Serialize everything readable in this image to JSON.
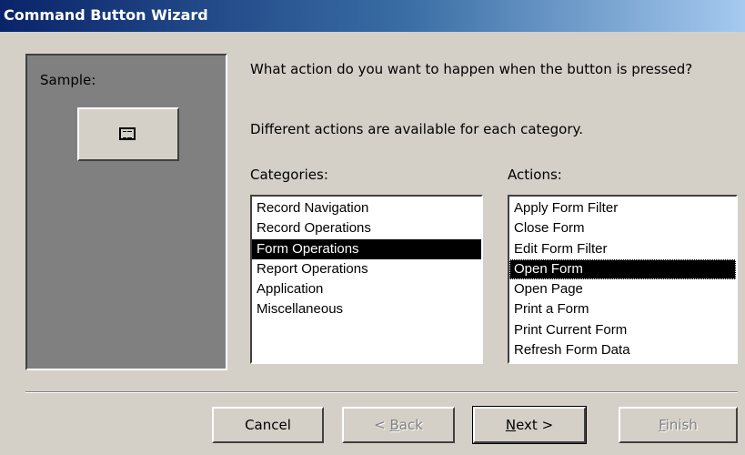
{
  "window": {
    "title": "Command Button Wizard"
  },
  "sample": {
    "label": "Sample:",
    "icon": "form-icon"
  },
  "question": "What action do you want to happen when the button is pressed?",
  "note": "Different actions are available for each category.",
  "categories": {
    "label": "Categories:",
    "items": [
      "Record Navigation",
      "Record Operations",
      "Form Operations",
      "Report Operations",
      "Application",
      "Miscellaneous"
    ],
    "selected": "Form Operations"
  },
  "actions": {
    "label": "Actions:",
    "items": [
      "Apply Form Filter",
      "Close Form",
      "Edit Form Filter",
      "Open Form",
      "Open Page",
      "Print a Form",
      "Print Current Form",
      "Refresh Form Data"
    ],
    "selected": "Open Form"
  },
  "buttons": {
    "cancel": "Cancel",
    "back_prefix": "< ",
    "back_mnemonic": "B",
    "back_rest": "ack",
    "next_mnemonic": "N",
    "next_rest": "ext >",
    "finish_mnemonic": "F",
    "finish_rest": "inish"
  }
}
